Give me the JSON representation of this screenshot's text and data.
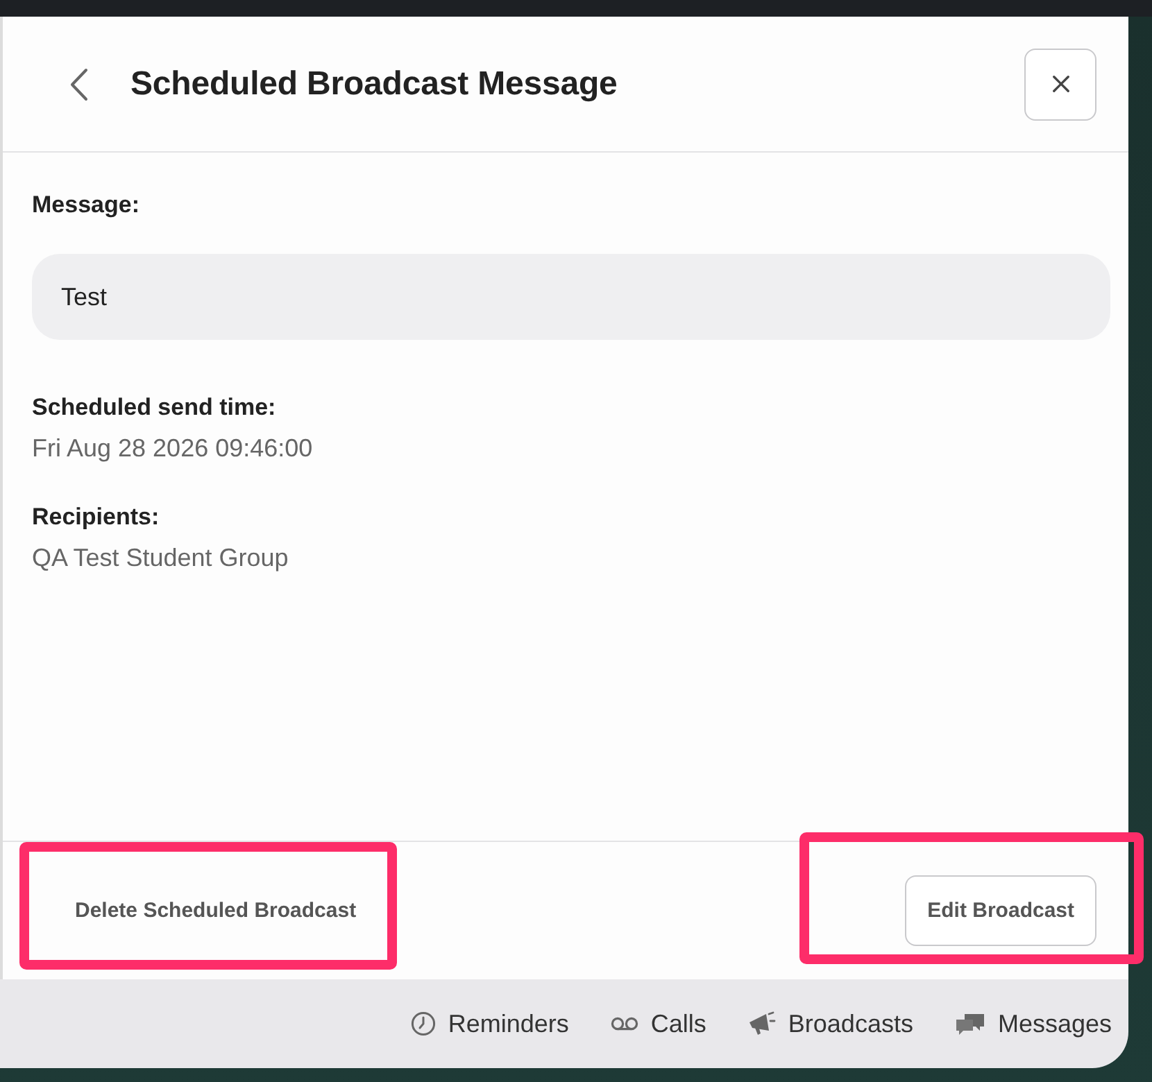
{
  "header": {
    "title": "Scheduled Broadcast Message"
  },
  "fields": [
    {
      "label": "Message:",
      "value": "Test",
      "kind": "box"
    },
    {
      "label": "Scheduled send time:",
      "value": "Fri Aug 28 2026 09:46:00",
      "kind": "text"
    },
    {
      "label": "Recipients:",
      "value": "QA Test Student Group",
      "kind": "text"
    }
  ],
  "footer": {
    "actions": [
      {
        "label": "Delete Scheduled Broadcast",
        "kind": "plain",
        "highlighted": true
      },
      {
        "label": "Edit Broadcast",
        "kind": "outlined",
        "highlighted": true
      }
    ]
  },
  "tab_bar": {
    "items": [
      {
        "label": "Reminders"
      },
      {
        "label": "Calls"
      },
      {
        "label": "Broadcasts"
      },
      {
        "label": "Messages"
      }
    ]
  }
}
